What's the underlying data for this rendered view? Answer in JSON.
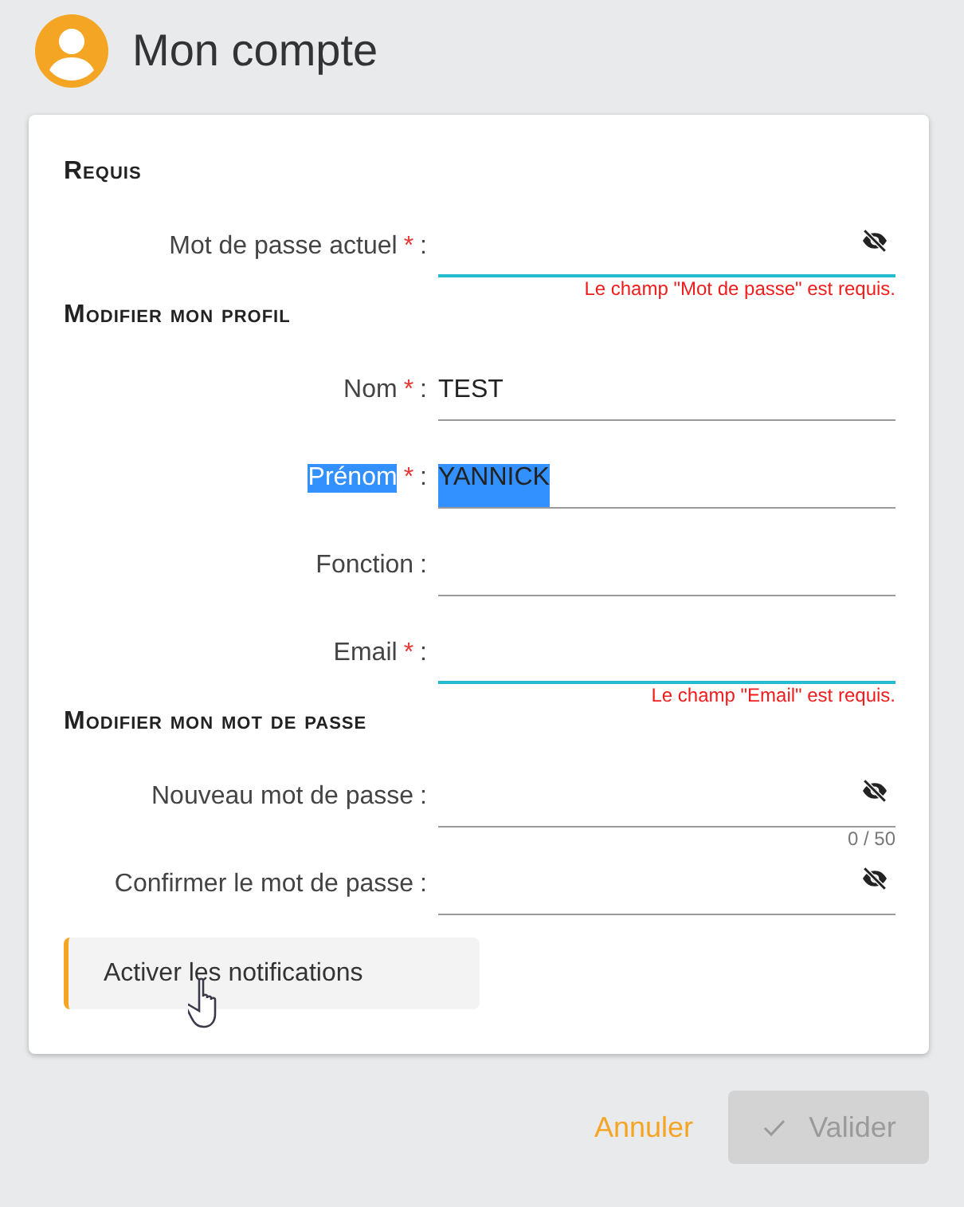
{
  "header": {
    "title": "Mon compte"
  },
  "sections": [
    {
      "title": "Requis",
      "fields": [
        {
          "label": "Mot de passe actuel",
          "required_mark": "*",
          "separator": ":",
          "kind": "password",
          "focused": true,
          "highlighted": false,
          "error": "Le champ \"Mot de passe\" est requis."
        }
      ]
    },
    {
      "title": "Modifier mon profil",
      "fields": [
        {
          "label": "Nom",
          "required_mark": "*",
          "separator": ":",
          "kind": "text",
          "value": "TEST",
          "focused": false,
          "highlighted": false
        },
        {
          "label": "Prénom",
          "required_mark": "*",
          "separator": ":",
          "kind": "text",
          "value": "YANNICK",
          "focused": false,
          "highlighted": true
        },
        {
          "label": "Fonction",
          "separator": ":",
          "kind": "text",
          "focused": false,
          "highlighted": false
        },
        {
          "label": "Email",
          "required_mark": "*",
          "separator": ":",
          "kind": "text",
          "focused": true,
          "highlighted": false,
          "error": "Le champ \"Email\" est requis."
        }
      ]
    },
    {
      "title": "Modifier mon mot de passe",
      "fields": [
        {
          "label": "Nouveau mot de passe",
          "separator": ":",
          "kind": "password",
          "focused": false,
          "highlighted": false,
          "counter": "0 / 50"
        },
        {
          "label": "Confirmer le mot de passe",
          "separator": ":",
          "kind": "password",
          "focused": false,
          "highlighted": false
        }
      ]
    }
  ],
  "notifications_button": {
    "label": "Activer les notifications"
  },
  "footer": {
    "cancel": {
      "label": "Annuler"
    },
    "submit": {
      "label": "Valider",
      "disabled": true
    }
  }
}
